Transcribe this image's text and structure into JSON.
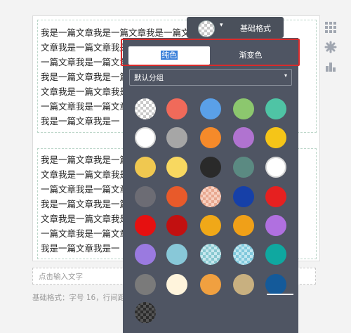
{
  "text_line_full": "我是一篇文章我是一篇文章我是一篇文章我是一篇",
  "text_line_wrap": "文章我是一篇文章我是一篇文章我是一篇文章我是一",
  "text_line_alt": "一篇文章我是一篇文章我是一篇文章我是一篇文章",
  "text_line_short": "我是一篇文章我是一",
  "placeholder_text": "点击输入文字",
  "footer_text": "基础格式：字号 16，行间距",
  "toolbar": {
    "label": "基础格式",
    "caret": "▾"
  },
  "tabs": {
    "solid": "纯色",
    "gradient": "渐变色"
  },
  "group_select": {
    "value": "默认分组",
    "arrow": "▾"
  },
  "colors": [
    "transparent",
    "#f06a5a",
    "#5aa0e8",
    "#8cc76e",
    "#4fc4a5",
    "#ffffff",
    "#a6a6a6",
    "#f58a2a",
    "#b073d0",
    "#f5c518",
    "#f0c850",
    "#f8d860",
    "#2a2a2a",
    "#5b8a82",
    "#ffffff",
    "#6c6c74",
    "#e85a2a",
    "#f0b8a8",
    "#1640a8",
    "#e62020",
    "#e61010",
    "#c21010",
    "#f0a818",
    "#f0a018",
    "#b070e0",
    "#9a7ae0",
    "#88c8d8",
    "#a8d8e0",
    "#a0d8e8",
    "#0fa8a0",
    "#7a7a7a",
    "#fff4dc",
    "#f0a040",
    "#c8b080",
    "#145a9a",
    "#3a3a3a"
  ],
  "icons": [
    "apps-grid-icon",
    "gear-icon",
    "bar-chart-icon",
    "chevron-down-icon"
  ]
}
